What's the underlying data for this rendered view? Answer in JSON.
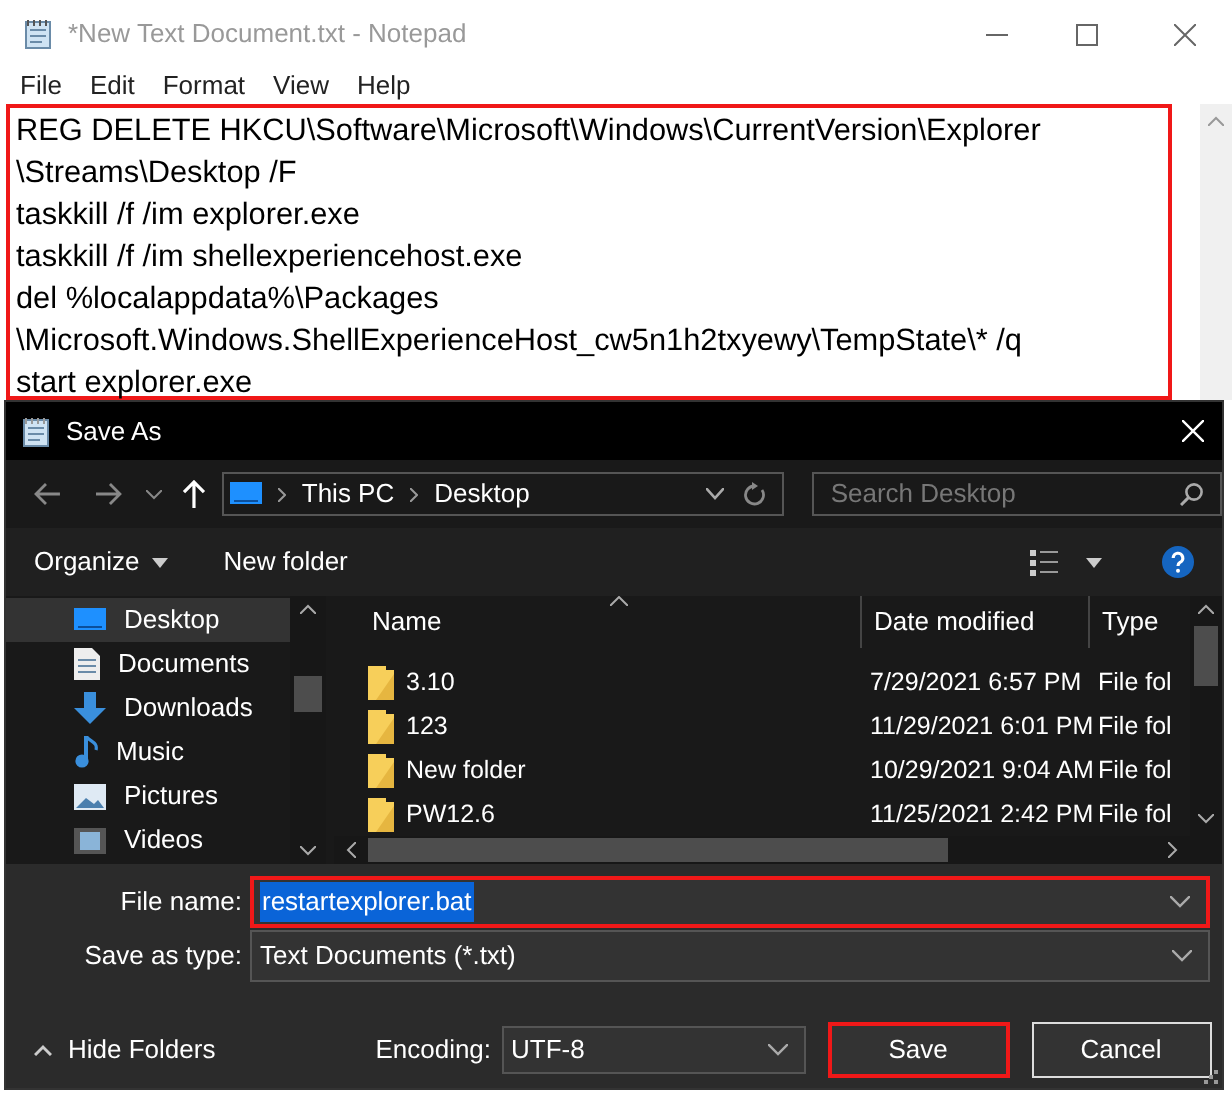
{
  "notepad": {
    "title": "*New Text Document.txt - Notepad",
    "menu": [
      "File",
      "Edit",
      "Format",
      "View",
      "Help"
    ],
    "lines": [
      "REG DELETE HKCU\\Software\\Microsoft\\Windows\\CurrentVersion\\Explorer",
      "\\Streams\\Desktop /F",
      "taskkill /f /im explorer.exe",
      "taskkill /f /im shellexperiencehost.exe",
      "del %localappdata%\\Packages",
      "\\Microsoft.Windows.ShellExperienceHost_cw5n1h2txyewy\\TempState\\* /q",
      "start explorer.exe"
    ],
    "highlighted": true
  },
  "dialog": {
    "title": "Save As",
    "breadcrumb": [
      "This PC",
      "Desktop"
    ],
    "search": {
      "placeholder": "Search Desktop"
    },
    "toolbar": {
      "organize": "Organize",
      "new_folder": "New folder"
    },
    "nav": [
      {
        "label": "Desktop",
        "selected": true
      },
      {
        "label": "Documents",
        "selected": false
      },
      {
        "label": "Downloads",
        "selected": false
      },
      {
        "label": "Music",
        "selected": false
      },
      {
        "label": "Pictures",
        "selected": false
      },
      {
        "label": "Videos",
        "selected": false
      }
    ],
    "columns": [
      "Name",
      "Date modified",
      "Type"
    ],
    "rows": [
      {
        "name": "3.10",
        "date": "7/29/2021 6:57 PM",
        "type": "File fol"
      },
      {
        "name": "123",
        "date": "11/29/2021 6:01 PM",
        "type": "File fol"
      },
      {
        "name": "New folder",
        "date": "10/29/2021 9:04 AM",
        "type": "File fol"
      },
      {
        "name": "PW12.6",
        "date": "11/25/2021 2:42 PM",
        "type": "File fol"
      }
    ],
    "file_name": {
      "label": "File name:",
      "value": "restartexplorer.bat",
      "highlighted": true
    },
    "save_type": {
      "label": "Save as type:",
      "value": "Text Documents (*.txt)"
    },
    "hide_folders": "Hide Folders",
    "encoding": {
      "label": "Encoding:",
      "value": "UTF-8"
    },
    "buttons": [
      {
        "label": "Save",
        "highlighted": true
      },
      {
        "label": "Cancel",
        "highlighted": false
      }
    ]
  }
}
